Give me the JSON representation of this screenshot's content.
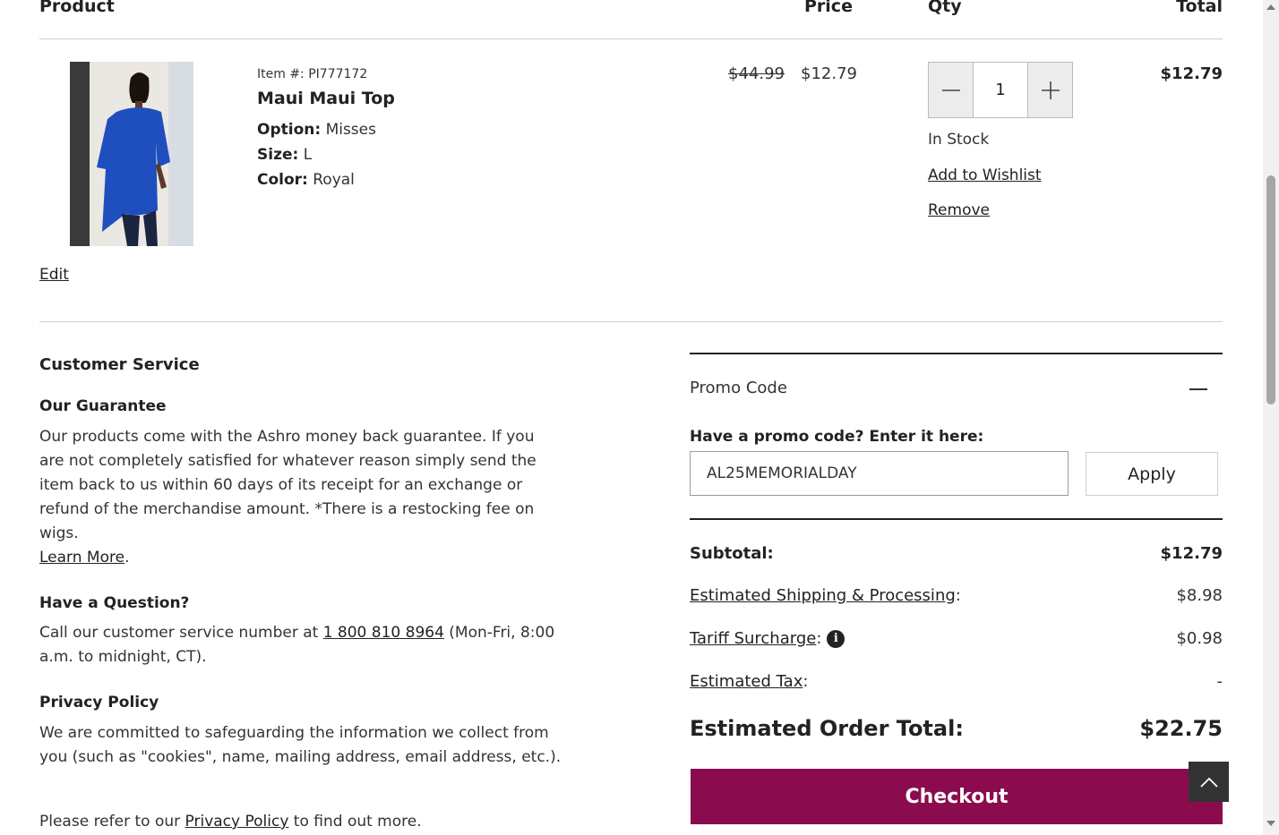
{
  "table_header": {
    "product": "Product",
    "price": "Price",
    "qty": "Qty",
    "total": "Total"
  },
  "item": {
    "item_no": "Item #: PI777172",
    "name": "Maui Maui Top",
    "option_label": "Option:",
    "option_value": "Misses",
    "size_label": "Size:",
    "size_value": "L",
    "color_label": "Color:",
    "color_value": "Royal",
    "original_price": "$44.99",
    "sale_price": "$12.79",
    "quantity": "1",
    "stock": "In Stock",
    "wishlist": "Add to Wishlist",
    "remove": "Remove",
    "line_total": "$12.79",
    "edit": "Edit"
  },
  "customer_service": {
    "title": "Customer Service",
    "guarantee_title": "Our Guarantee",
    "guarantee_text": "Our products come with the Ashro money back guarantee. If you are not completely satisfied for whatever reason simply send the item back to us within 60 days of its receipt for an exchange or refund of the merchandise amount. *There is a restocking fee on wigs.",
    "learn_more": "Learn More",
    "question_title": "Have a Question?",
    "question_text_before": "Call our customer service number at ",
    "phone": "1 800 810 8964",
    "question_text_after": " (Mon-Fri, 8:00 a.m. to midnight, CT).",
    "privacy_title": "Privacy Policy",
    "privacy_text": "We are committed to safeguarding the information we collect from you (such as \"cookies\", name, mailing address, email address, etc.).",
    "privacy_refer_before": "Please refer to our ",
    "privacy_link": "Privacy Policy",
    "privacy_refer_after": " to find out more."
  },
  "promo": {
    "title": "Promo Code",
    "label": "Have a promo code? Enter it here:",
    "value": "AL25MEMORIALDAY",
    "apply": "Apply"
  },
  "summary": {
    "subtotal_label": "Subtotal:",
    "subtotal_value": "$12.79",
    "shipping_label": "Estimated Shipping & Processing",
    "shipping_value": "$8.98",
    "tariff_label": "Tariff Surcharge",
    "tariff_value": "$0.98",
    "tax_label": "Estimated Tax",
    "tax_value": "-",
    "total_label": "Estimated Order Total:",
    "total_value": "$22.75",
    "checkout": "Checkout"
  },
  "colors": {
    "checkout": "#8b0c4e",
    "product_blue": "#1f4fbf"
  },
  "icons": {
    "minus": "minus-icon",
    "plus": "plus-icon",
    "info": "info-icon",
    "collapse": "collapse-icon",
    "back_to_top": "chevron-up-icon"
  }
}
